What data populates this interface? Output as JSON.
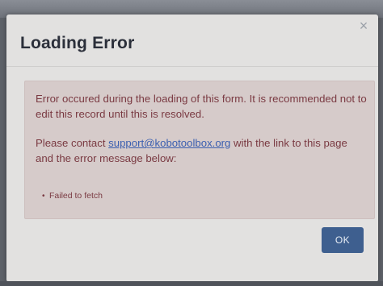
{
  "modal": {
    "title": "Loading Error",
    "close_symbol": "×",
    "message": {
      "para1": "Error occured during the loading of this form. It is recommended not to edit this record until this is resolved.",
      "para2_prefix": "Please contact ",
      "support_email": "support@kobotoolbox.org",
      "para2_suffix": " with the link to this page and the error message below:"
    },
    "errors": [
      "Failed to fetch"
    ],
    "ok_label": "OK"
  },
  "icons": {
    "close": "close-icon"
  },
  "colors": {
    "modal_background": "#e2e1e0",
    "alert_background": "#d6cbca",
    "alert_text": "#7a3a42",
    "link": "#3b5fb0",
    "button_background": "#3e5f8f"
  }
}
